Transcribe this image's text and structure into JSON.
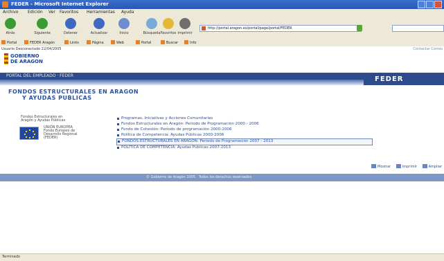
{
  "window": {
    "title": "FEDER - Microsoft Internet Explorer"
  },
  "menu": [
    "Archivo",
    "Edición",
    "Ver",
    "Favoritos",
    "Herramientas",
    "Ayuda"
  ],
  "toolbar": {
    "buttons": [
      {
        "label": "Atrás",
        "icon": "back-arrow-icon",
        "color": "#3a9a33"
      },
      {
        "label": "Siguiente",
        "icon": "forward-arrow-icon",
        "color": "#3a9a33"
      },
      {
        "label": "Detener",
        "icon": "stop-icon",
        "color": "#3f68c2"
      },
      {
        "label": "Actualizar",
        "icon": "refresh-icon",
        "color": "#3f68c2"
      },
      {
        "label": "Inicio",
        "icon": "home-icon",
        "color": "#6f8ccf"
      },
      {
        "label": "Búsqueda",
        "icon": "search-icon",
        "color": "#7aa9da"
      },
      {
        "label": "Favoritos",
        "icon": "favorites-icon",
        "color": "#e6b83a"
      },
      {
        "label": "Imprimir",
        "icon": "print-icon",
        "color": "#6f6f6f"
      }
    ],
    "address": "http://portal.aragon.es/portal/page/portal/FEDER",
    "go_label": "Ir"
  },
  "links_bar": [
    "Portal",
    "FEDER Aragón",
    "Links",
    "Página",
    "Web",
    "Portal",
    "Buscar",
    "Info"
  ],
  "site": {
    "user_info": "Usuario Desconectado  22/04/2005",
    "logo_text": "GOBIERNO\nDE ARAGON",
    "top_links": "Contactar   Correo",
    "nav": "PORTAL DEL EMPLEADO · FEDER",
    "feder": "FEDER",
    "heading": [
      "FONDOS ESTRUCTURALES EN ARAGON",
      "Y AYUDAS PUBLICAS"
    ],
    "eu_text": "Fondos Estructurales en\nAragón y Ayudas Públicas",
    "eu_fund": "UNIÓN EUROPEA\nFondo Europeo de\nDesarrollo Regional\n(FEDER)",
    "menu": [
      {
        "label": "Programas, Iniciativas y Acciones Comunitarias",
        "selected": false
      },
      {
        "label": "Fondos Estructurales en Aragón: Periodo de Programación 2000 - 2006",
        "selected": false
      },
      {
        "label": "Fondo de Cohesión: Periodo de programación 2000-2006",
        "selected": false
      },
      {
        "label": "Política de Competencia: Ayudas Públicas 2000-2006",
        "selected": false
      },
      {
        "label": "FONDOS ESTRUCTURALES EN ARAGÓN: Periodo de Programación 2007 - 2013",
        "selected": true
      },
      {
        "label": "POLÍTICA DE COMPETENCIA: Ayudas Públicas 2007-2013",
        "selected": false
      }
    ],
    "actions": [
      "Mostrar",
      "Imprimir",
      "Ampliar"
    ],
    "footer": "© Gobierno de Aragón 2005 · Todos los derechos reservados"
  },
  "status": "Terminado"
}
